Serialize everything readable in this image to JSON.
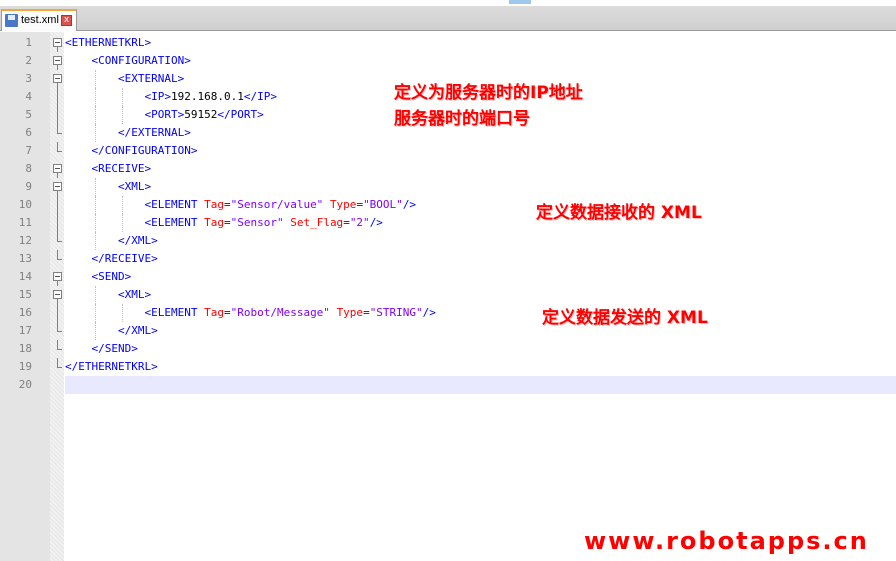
{
  "tab": {
    "title": "test.xml",
    "close_glyph": "x"
  },
  "lines": [
    {
      "n": "1",
      "t": [
        [
          "tg",
          "<ETHERNETKRL>"
        ]
      ]
    },
    {
      "n": "2",
      "t": [
        [
          "tx",
          "    "
        ],
        [
          "tg",
          "<CONFIGURATION>"
        ]
      ]
    },
    {
      "n": "3",
      "t": [
        [
          "tx",
          "        "
        ],
        [
          "tg",
          "<EXTERNAL>"
        ]
      ]
    },
    {
      "n": "4",
      "t": [
        [
          "tx",
          "            "
        ],
        [
          "tg",
          "<IP>"
        ],
        [
          "tx",
          "192.168.0.1"
        ],
        [
          "tg",
          "</IP>"
        ]
      ]
    },
    {
      "n": "5",
      "t": [
        [
          "tx",
          "            "
        ],
        [
          "tg",
          "<PORT>"
        ],
        [
          "tx",
          "59152"
        ],
        [
          "tg",
          "</PORT>"
        ]
      ]
    },
    {
      "n": "6",
      "t": [
        [
          "tx",
          "        "
        ],
        [
          "tg",
          "</EXTERNAL>"
        ]
      ]
    },
    {
      "n": "7",
      "t": [
        [
          "tx",
          "    "
        ],
        [
          "tg",
          "</CONFIGURATION>"
        ]
      ]
    },
    {
      "n": "8",
      "t": [
        [
          "tx",
          "    "
        ],
        [
          "tg",
          "<RECEIVE>"
        ]
      ]
    },
    {
      "n": "9",
      "t": [
        [
          "tx",
          "        "
        ],
        [
          "tg",
          "<XML>"
        ]
      ]
    },
    {
      "n": "10",
      "t": [
        [
          "tx",
          "            "
        ],
        [
          "tg",
          "<ELEMENT "
        ],
        [
          "at",
          "Tag"
        ],
        [
          "tg",
          "="
        ],
        [
          "av",
          "\"Sensor/value\""
        ],
        [
          "tg",
          " "
        ],
        [
          "at",
          "Type"
        ],
        [
          "tg",
          "="
        ],
        [
          "av",
          "\"BOOL\""
        ],
        [
          "tg",
          "/>"
        ]
      ]
    },
    {
      "n": "11",
      "t": [
        [
          "tx",
          "            "
        ],
        [
          "tg",
          "<ELEMENT "
        ],
        [
          "at",
          "Tag"
        ],
        [
          "tg",
          "="
        ],
        [
          "av",
          "\"Sensor\""
        ],
        [
          "tg",
          " "
        ],
        [
          "at",
          "Set_Flag"
        ],
        [
          "tg",
          "="
        ],
        [
          "av",
          "\"2\""
        ],
        [
          "tg",
          "/>"
        ]
      ]
    },
    {
      "n": "12",
      "t": [
        [
          "tx",
          "        "
        ],
        [
          "tg",
          "</XML>"
        ]
      ]
    },
    {
      "n": "13",
      "t": [
        [
          "tx",
          "    "
        ],
        [
          "tg",
          "</RECEIVE>"
        ]
      ]
    },
    {
      "n": "14",
      "t": [
        [
          "tx",
          "    "
        ],
        [
          "tg",
          "<SEND>"
        ]
      ]
    },
    {
      "n": "15",
      "t": [
        [
          "tx",
          "        "
        ],
        [
          "tg",
          "<XML>"
        ]
      ]
    },
    {
      "n": "16",
      "t": [
        [
          "tx",
          "            "
        ],
        [
          "tg",
          "<ELEMENT "
        ],
        [
          "at",
          "Tag"
        ],
        [
          "tg",
          "="
        ],
        [
          "av",
          "\"Robot/Message\""
        ],
        [
          "tg",
          " "
        ],
        [
          "at",
          "Type"
        ],
        [
          "tg",
          "="
        ],
        [
          "av",
          "\"STRING\""
        ],
        [
          "tg",
          "/>"
        ]
      ]
    },
    {
      "n": "17",
      "t": [
        [
          "tx",
          "        "
        ],
        [
          "tg",
          "</XML>"
        ]
      ]
    },
    {
      "n": "18",
      "t": [
        [
          "tx",
          "    "
        ],
        [
          "tg",
          "</SEND>"
        ]
      ]
    },
    {
      "n": "19",
      "t": [
        [
          "tg",
          "</ETHERNETKRL>"
        ]
      ]
    },
    {
      "n": "20",
      "t": []
    }
  ],
  "fold_markers": [
    "box",
    "box",
    "box",
    "vline",
    "vline",
    "end",
    "end",
    "box",
    "box",
    "vline",
    "vline",
    "end",
    "end",
    "box",
    "box",
    "vline",
    "end",
    "end",
    "end",
    ""
  ],
  "annotations": {
    "server_line1": "定义为服务器时的IP地址",
    "server_line2": "服务器时的端口号",
    "receive": "定义数据接收的 XML",
    "send": "定义数据发送的 XML"
  },
  "watermark": "www.robotapps.cn",
  "colors": {
    "tag": "#0000ff",
    "attr": "#ff0000",
    "value": "#8000ff",
    "note": "#ff0000"
  }
}
